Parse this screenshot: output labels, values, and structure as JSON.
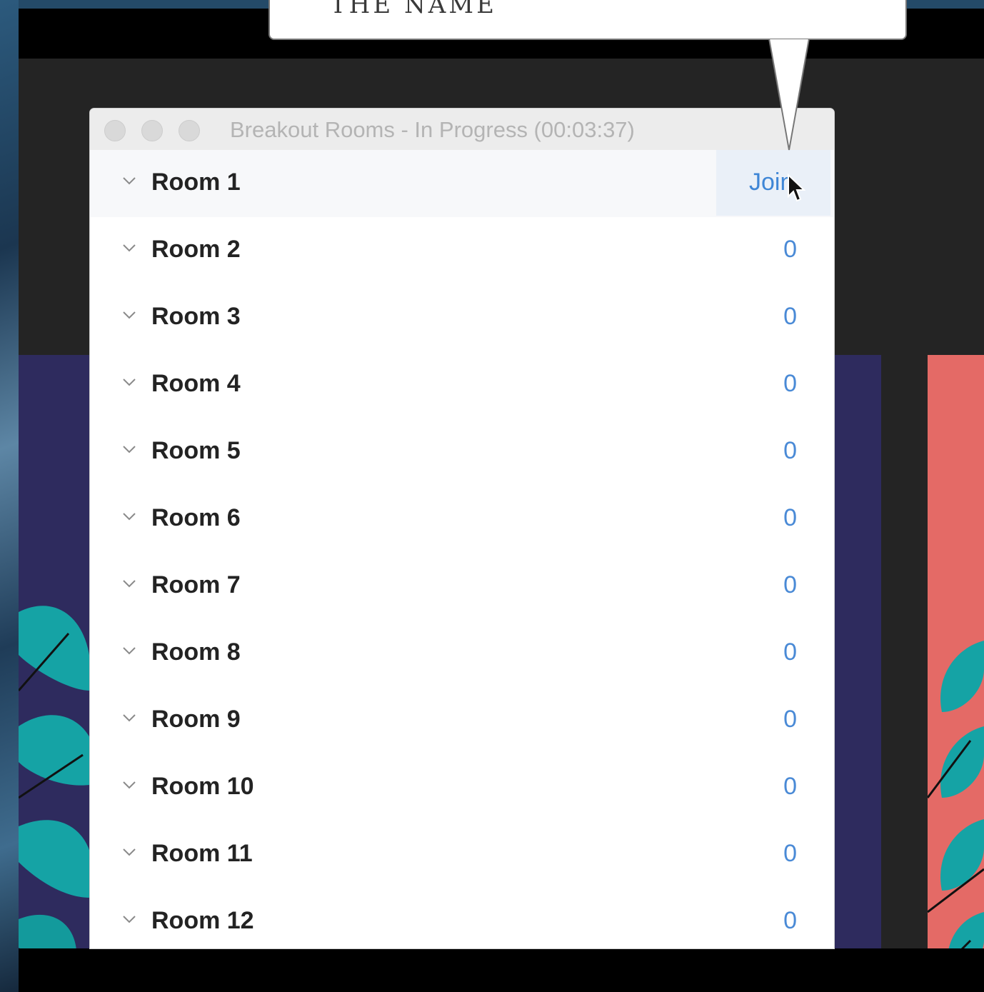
{
  "callout": {
    "text": "THE NAME"
  },
  "window": {
    "title": "Breakout Rooms - In Progress (00:03:37)"
  },
  "rooms": [
    {
      "name": "Room 1",
      "count": "",
      "action": "Join",
      "highlighted": true
    },
    {
      "name": "Room 2",
      "count": "0"
    },
    {
      "name": "Room 3",
      "count": "0"
    },
    {
      "name": "Room 4",
      "count": "0"
    },
    {
      "name": "Room 5",
      "count": "0"
    },
    {
      "name": "Room 6",
      "count": "0"
    },
    {
      "name": "Room 7",
      "count": "0"
    },
    {
      "name": "Room 8",
      "count": "0"
    },
    {
      "name": "Room 9",
      "count": "0"
    },
    {
      "name": "Room 10",
      "count": "0"
    },
    {
      "name": "Room 11",
      "count": "0"
    },
    {
      "name": "Room 12",
      "count": "0"
    }
  ],
  "icons": {
    "row_expand": "chevron-down-icon",
    "pointer": "mouse-cursor-icon",
    "window_controls": [
      "close-button",
      "minimize-button",
      "zoom-button"
    ]
  },
  "colors": {
    "accent": "#3f86d6",
    "count_text": "#4a8ad6",
    "room_text": "#232323",
    "title_text": "#b4b4b4",
    "join_hover_bg": "#eaf0f8"
  }
}
